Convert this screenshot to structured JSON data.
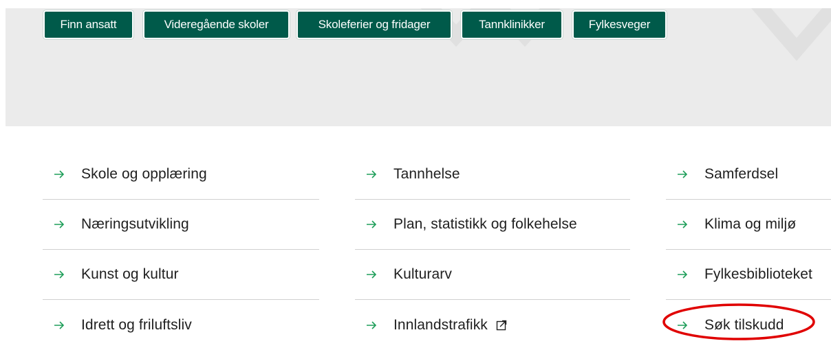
{
  "quick_links": [
    {
      "label": "Finn ansatt"
    },
    {
      "label": "Videregående skoler"
    },
    {
      "label": "Skoleferier og fridager"
    },
    {
      "label": "Tannklinikker"
    },
    {
      "label": "Fylkesveger"
    }
  ],
  "topics": {
    "col1": [
      {
        "label": "Skole og opplæring"
      },
      {
        "label": "Næringsutvikling"
      },
      {
        "label": "Kunst og kultur"
      },
      {
        "label": "Idrett og friluftsliv"
      }
    ],
    "col2": [
      {
        "label": "Tannhelse"
      },
      {
        "label": "Plan, statistikk og folkehelse"
      },
      {
        "label": "Kulturarv"
      },
      {
        "label": "Innlandstrafikk",
        "external": true
      }
    ],
    "col3": [
      {
        "label": "Samferdsel"
      },
      {
        "label": "Klima og miljø"
      },
      {
        "label": "Fylkesbiblioteket"
      },
      {
        "label": "Søk tilskudd",
        "highlighted": true
      }
    ]
  },
  "colors": {
    "button_bg": "#005a4a",
    "arrow": "#1f9e5a",
    "highlight": "#e00000",
    "hero_bg": "#ebebeb"
  },
  "icons": {
    "arrow": "arrow-right-icon",
    "external": "external-link-icon"
  }
}
